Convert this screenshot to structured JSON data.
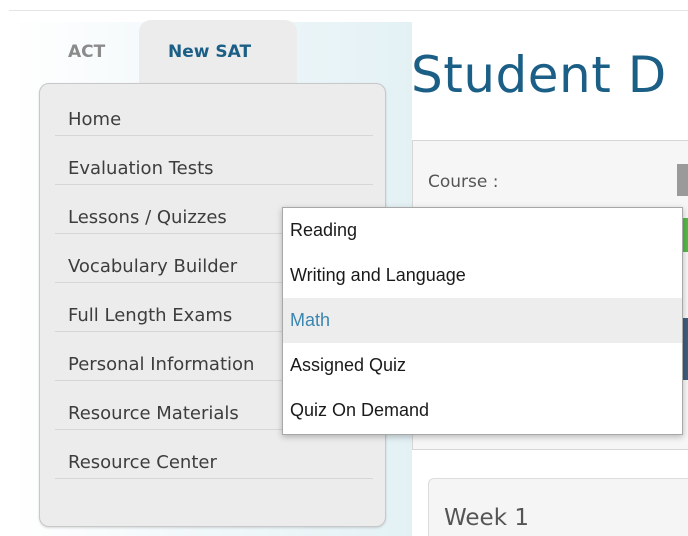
{
  "tabs": {
    "act": "ACT",
    "new_sat": "New SAT"
  },
  "sidebar": {
    "items": [
      {
        "label": "Home"
      },
      {
        "label": "Evaluation Tests"
      },
      {
        "label": "Lessons / Quizzes"
      },
      {
        "label": "Vocabulary Builder"
      },
      {
        "label": "Full Length Exams"
      },
      {
        "label": "Personal Information"
      },
      {
        "label": "Resource Materials"
      },
      {
        "label": "Resource Center"
      }
    ]
  },
  "main": {
    "title": "Student D",
    "course_label": "Course :",
    "week_label": "Week 1"
  },
  "dropdown": {
    "items": [
      {
        "label": "Reading",
        "selected": false
      },
      {
        "label": "Writing and Language",
        "selected": false
      },
      {
        "label": "Math",
        "selected": true
      },
      {
        "label": "Assigned Quiz",
        "selected": false
      },
      {
        "label": "Quiz On Demand",
        "selected": false
      }
    ]
  },
  "colors": {
    "accent": "#1b5f86",
    "selected_text": "#3a86b0",
    "green": "#54b848"
  }
}
